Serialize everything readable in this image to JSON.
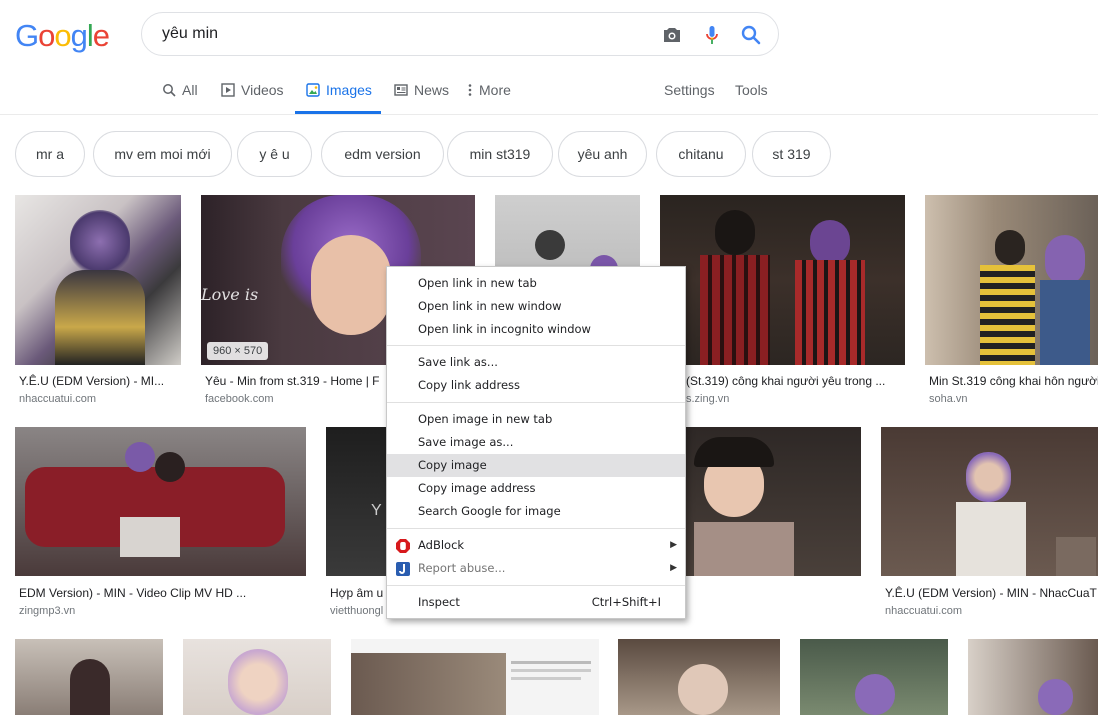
{
  "logo": {
    "letters": [
      "G",
      "o",
      "o",
      "g",
      "l",
      "e"
    ],
    "colors": [
      "#4285f4",
      "#ea4335",
      "#fbbc05",
      "#4285f4",
      "#34a853",
      "#ea4335"
    ]
  },
  "search": {
    "query": "yêu min",
    "icons": [
      "camera-icon",
      "mic-icon",
      "search-icon"
    ]
  },
  "tabs": [
    {
      "label": "All",
      "icon": "search-icon",
      "active": false
    },
    {
      "label": "Videos",
      "icon": "video-icon",
      "active": false
    },
    {
      "label": "Images",
      "icon": "image-icon",
      "active": true
    },
    {
      "label": "News",
      "icon": "news-icon",
      "active": false
    },
    {
      "label": "More",
      "icon": "more-dots-icon",
      "active": false
    }
  ],
  "tools": {
    "settings": "Settings",
    "tools": "Tools"
  },
  "chips": [
    "mr a",
    "mv em moi mới",
    "y ê u",
    "edm version",
    "min st319",
    "yêu anh",
    "chitanu",
    "st 319"
  ],
  "results_row1": [
    {
      "caption": "Y.Ê.U (EDM Version) - MI...",
      "source": "nhaccuatui.com"
    },
    {
      "caption": "Yêu - Min from st.319 - Home | F",
      "source": "facebook.com",
      "size": "960 × 570"
    },
    {
      "caption": "",
      "source": ""
    },
    {
      "caption": "(St.319) công khai người yêu trong ...",
      "source": "s.zing.vn"
    },
    {
      "caption": "Min St.319 công khai hôn người",
      "source": "soha.vn"
    }
  ],
  "results_row2": [
    {
      "caption": "EDM Version) - MIN - Video Clip MV HD ...",
      "source": "zingmp3.vn"
    },
    {
      "caption": "Hợp âm u",
      "source": "vietthuongl"
    },
    {
      "caption": "",
      "source": ""
    },
    {
      "caption": "Y.Ê.U (EDM Version) - MIN - NhacCuaT",
      "source": "nhaccuatui.com"
    }
  ],
  "context_menu": {
    "groups": [
      [
        {
          "label": "Open link in new tab"
        },
        {
          "label": "Open link in new window"
        },
        {
          "label": "Open link in incognito window"
        }
      ],
      [
        {
          "label": "Save link as..."
        },
        {
          "label": "Copy link address"
        }
      ],
      [
        {
          "label": "Open image in new tab"
        },
        {
          "label": "Save image as..."
        },
        {
          "label": "Copy image",
          "highlighted": true
        },
        {
          "label": "Copy image address"
        },
        {
          "label": "Search Google for image"
        }
      ],
      [
        {
          "label": "AdBlock",
          "icon": "adblock-icon",
          "submenu": true
        },
        {
          "label": "Report abuse...",
          "icon": "report-icon",
          "submenu": true,
          "disabled": true
        }
      ],
      [
        {
          "label": "Inspect",
          "shortcut": "Ctrl+Shift+I"
        }
      ]
    ]
  },
  "colors": {
    "accent": "#1a73e8",
    "menu_highlight": "#e1e1e3"
  }
}
